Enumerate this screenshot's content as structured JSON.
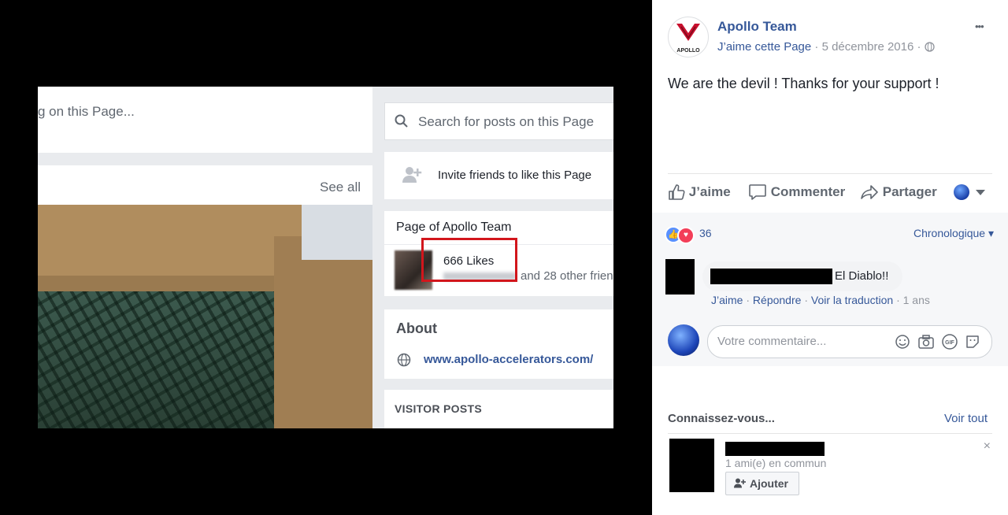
{
  "screenshot": {
    "search_partial": "g on this Page...",
    "see_all": "See all",
    "search_placeholder": "Search for posts on this Page",
    "invite": "Invite friends to like this Page",
    "page_of": "Page of Apollo Team",
    "likes": "666 Likes",
    "friends_like": "and 28 other frien",
    "about_title": "About",
    "website": "www.apollo-accelerators.com/",
    "visitor_posts": "VISITOR POSTS"
  },
  "post": {
    "logo_text": "APOLLO",
    "author": "Apollo Team",
    "meta_like": "J’aime cette Page",
    "meta_sep": "·",
    "meta_date": "5 décembre 2016",
    "meta_sep2": "·",
    "more": "•••",
    "text": "We are the devil ! Thanks for your support !",
    "actions": {
      "like": "J’aime",
      "comment": "Commenter",
      "share": "Partager"
    },
    "reaction_count": "36",
    "sort": "Chronologique ▾"
  },
  "comment": {
    "text": "El Diablo!!",
    "like": "J’aime",
    "sep1": "·",
    "reply": "Répondre",
    "sep2": "·",
    "translate": "Voir la traduction",
    "sep3": "·",
    "time": "1 ans"
  },
  "composer": {
    "placeholder": "Votre commentaire..."
  },
  "pymk": {
    "title": "Connaissez-vous...",
    "see_all": "Voir tout",
    "mutual": "1 ami(e) en commun",
    "add": "Ajouter",
    "close": "×"
  },
  "colors": {
    "fb_blue": "#365899",
    "highlight_red": "#d2161c"
  }
}
